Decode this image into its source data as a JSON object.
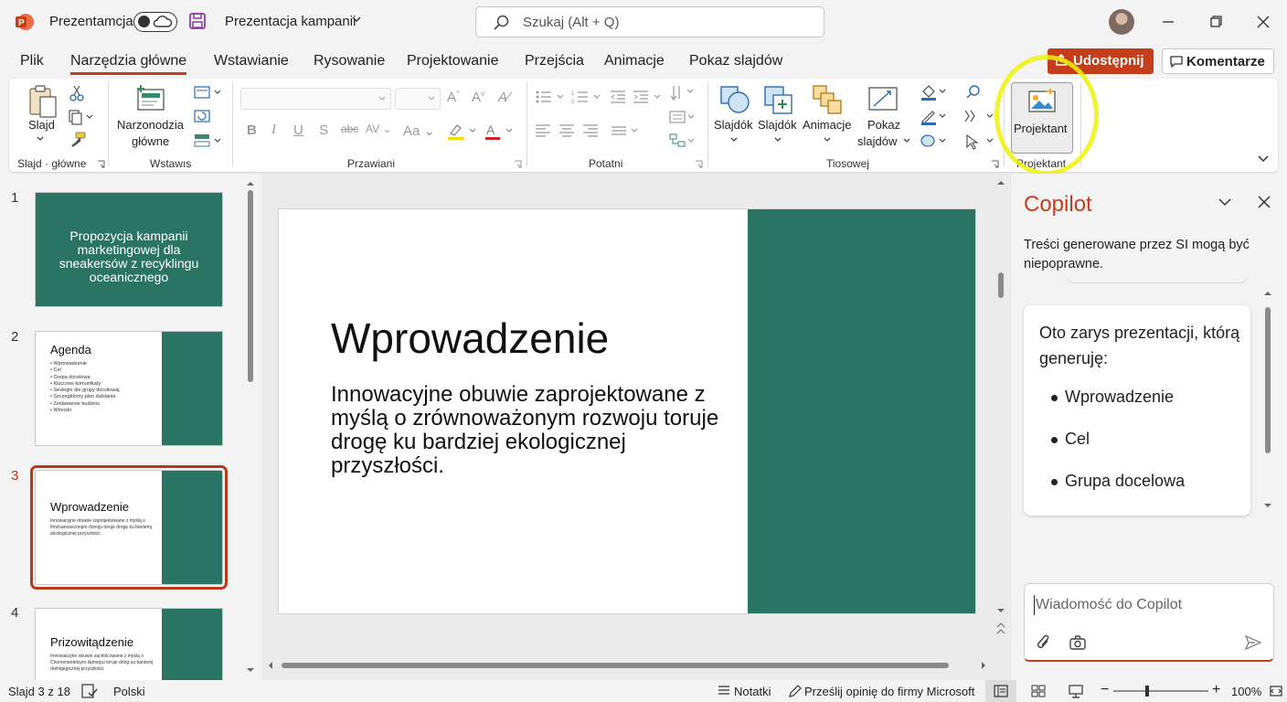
{
  "titlebar": {
    "autosave_label": "Prezentamcja",
    "doc_title": "Prezentacja kampanii",
    "search_placeholder": "Szukaj (Alt + Q)"
  },
  "menu": {
    "tabs": [
      "Plik",
      "Narzędzia główne",
      "Wstawianie",
      "Rysowanie",
      "Projektowanie",
      "Przejścia",
      "Animacje",
      "Pokaz slajdów"
    ],
    "active_tab": "Narzędzia główne",
    "share_label": "Udostępnij",
    "comments_label": "Komentarze"
  },
  "ribbon": {
    "slide_label": "Slajd",
    "tools_label_line1": "Narzonodzia",
    "tools_label_line2": "główne",
    "slides_btn": "Slajdók",
    "slides_btn2": "Slajdók",
    "animations_btn": "Animacje",
    "slideshow_line1": "Pokaz",
    "slideshow_line2": "slajdów",
    "designer_btn": "Projektant",
    "groups": {
      "slides": "Slajd · główne",
      "insert": "Wstawıs",
      "format": "Przawiani",
      "paragraph": "Potatni",
      "drawing": "Tiosowej",
      "designer": "Projektant"
    }
  },
  "thumbnails": [
    {
      "num": "1",
      "title": "Propozycja kampanii marketingowej dla sneakersów z recyklingu oceanicznego"
    },
    {
      "num": "2",
      "title": "Agenda",
      "items": [
        "Wprowadzenie",
        "Cel",
        "Grepa docelowa",
        "Kiuccoes komunikaty",
        "Sexlegle die grupy docsliowaj",
        "Szczegblomy plen dalslania",
        "Zestawienie budżetu",
        "Wmoski"
      ]
    },
    {
      "num": "3",
      "title": "Wprowadzenie",
      "body": "Innowacyjne obuwie zaprojektowane z myślą o Ilmżoanoasconpm rlonoju toruje drogę ku bantemj alcologicznej przyszłości."
    },
    {
      "num": "4",
      "title": "Prizowitądzenie",
      "body": "Imnowaczjne obuwin zacrlolcowane z myślą o Chomenentetsym ilamorpu toruje drlog ou bantemj drehlgegicznej przyszłości."
    }
  ],
  "slide": {
    "title": "Wprowadzenie",
    "body": "Innowacyjne obuwie zaprojektowane z myślą o zrównoważonym rozwoju toruje drogę ku bardziej ekologicznej przyszłości."
  },
  "copilot": {
    "title": "Copilot",
    "disclaimer": "Treści generowane przez SI mogą być niepoprawne.",
    "message_intro": "Oto zarys prezentacji, którą generuję:",
    "outline": [
      "Wprowadzenie",
      "Cel",
      "Grupa docelowa"
    ],
    "input_placeholder": "Wiadomość do Copilot"
  },
  "statusbar": {
    "slide_counter": "Slajd 3 z 18",
    "language": "Polski",
    "notes": "Notatki",
    "feedback": "Prześlij opinię do firmy Microsoft",
    "zoom": "100%"
  },
  "colors": {
    "accent": "#c43e1c",
    "slide_green": "#2a7463",
    "highlight": "#eef20a"
  }
}
